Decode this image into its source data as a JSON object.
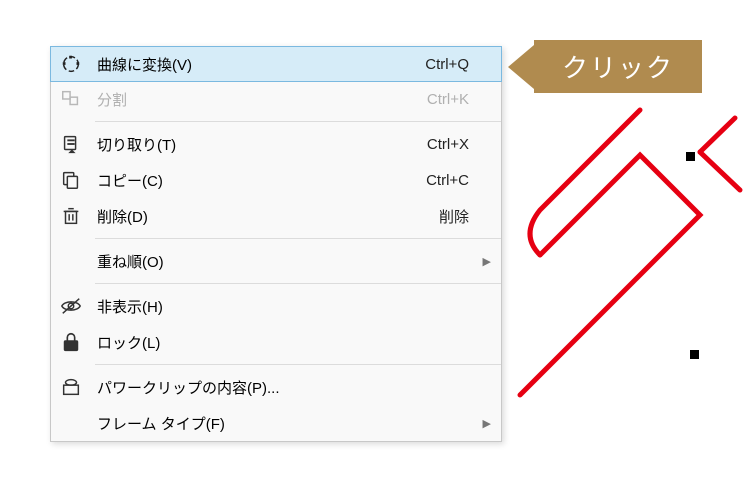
{
  "callout": {
    "label": "クリック"
  },
  "menu": {
    "convert_to_curve": {
      "label": "曲線に変換(V)",
      "shortcut": "Ctrl+Q"
    },
    "split": {
      "label": "分割",
      "shortcut": "Ctrl+K"
    },
    "cut": {
      "label": "切り取り(T)",
      "shortcut": "Ctrl+X"
    },
    "copy": {
      "label": "コピー(C)",
      "shortcut": "Ctrl+C"
    },
    "delete": {
      "label": "削除(D)",
      "shortcut": "削除"
    },
    "order": {
      "label": "重ね順(O)",
      "shortcut": ""
    },
    "hide": {
      "label": "非表示(H)",
      "shortcut": ""
    },
    "lock": {
      "label": "ロック(L)",
      "shortcut": ""
    },
    "powerclip": {
      "label": "パワークリップの内容(P)...",
      "shortcut": ""
    },
    "frame_type": {
      "label": "フレーム タイプ(F)",
      "shortcut": ""
    }
  },
  "colors": {
    "highlight_bg": "#d6ecf8",
    "highlight_border": "#7bb9e0",
    "callout_bg": "#b08b4f",
    "artwork_stroke": "#e60012"
  }
}
